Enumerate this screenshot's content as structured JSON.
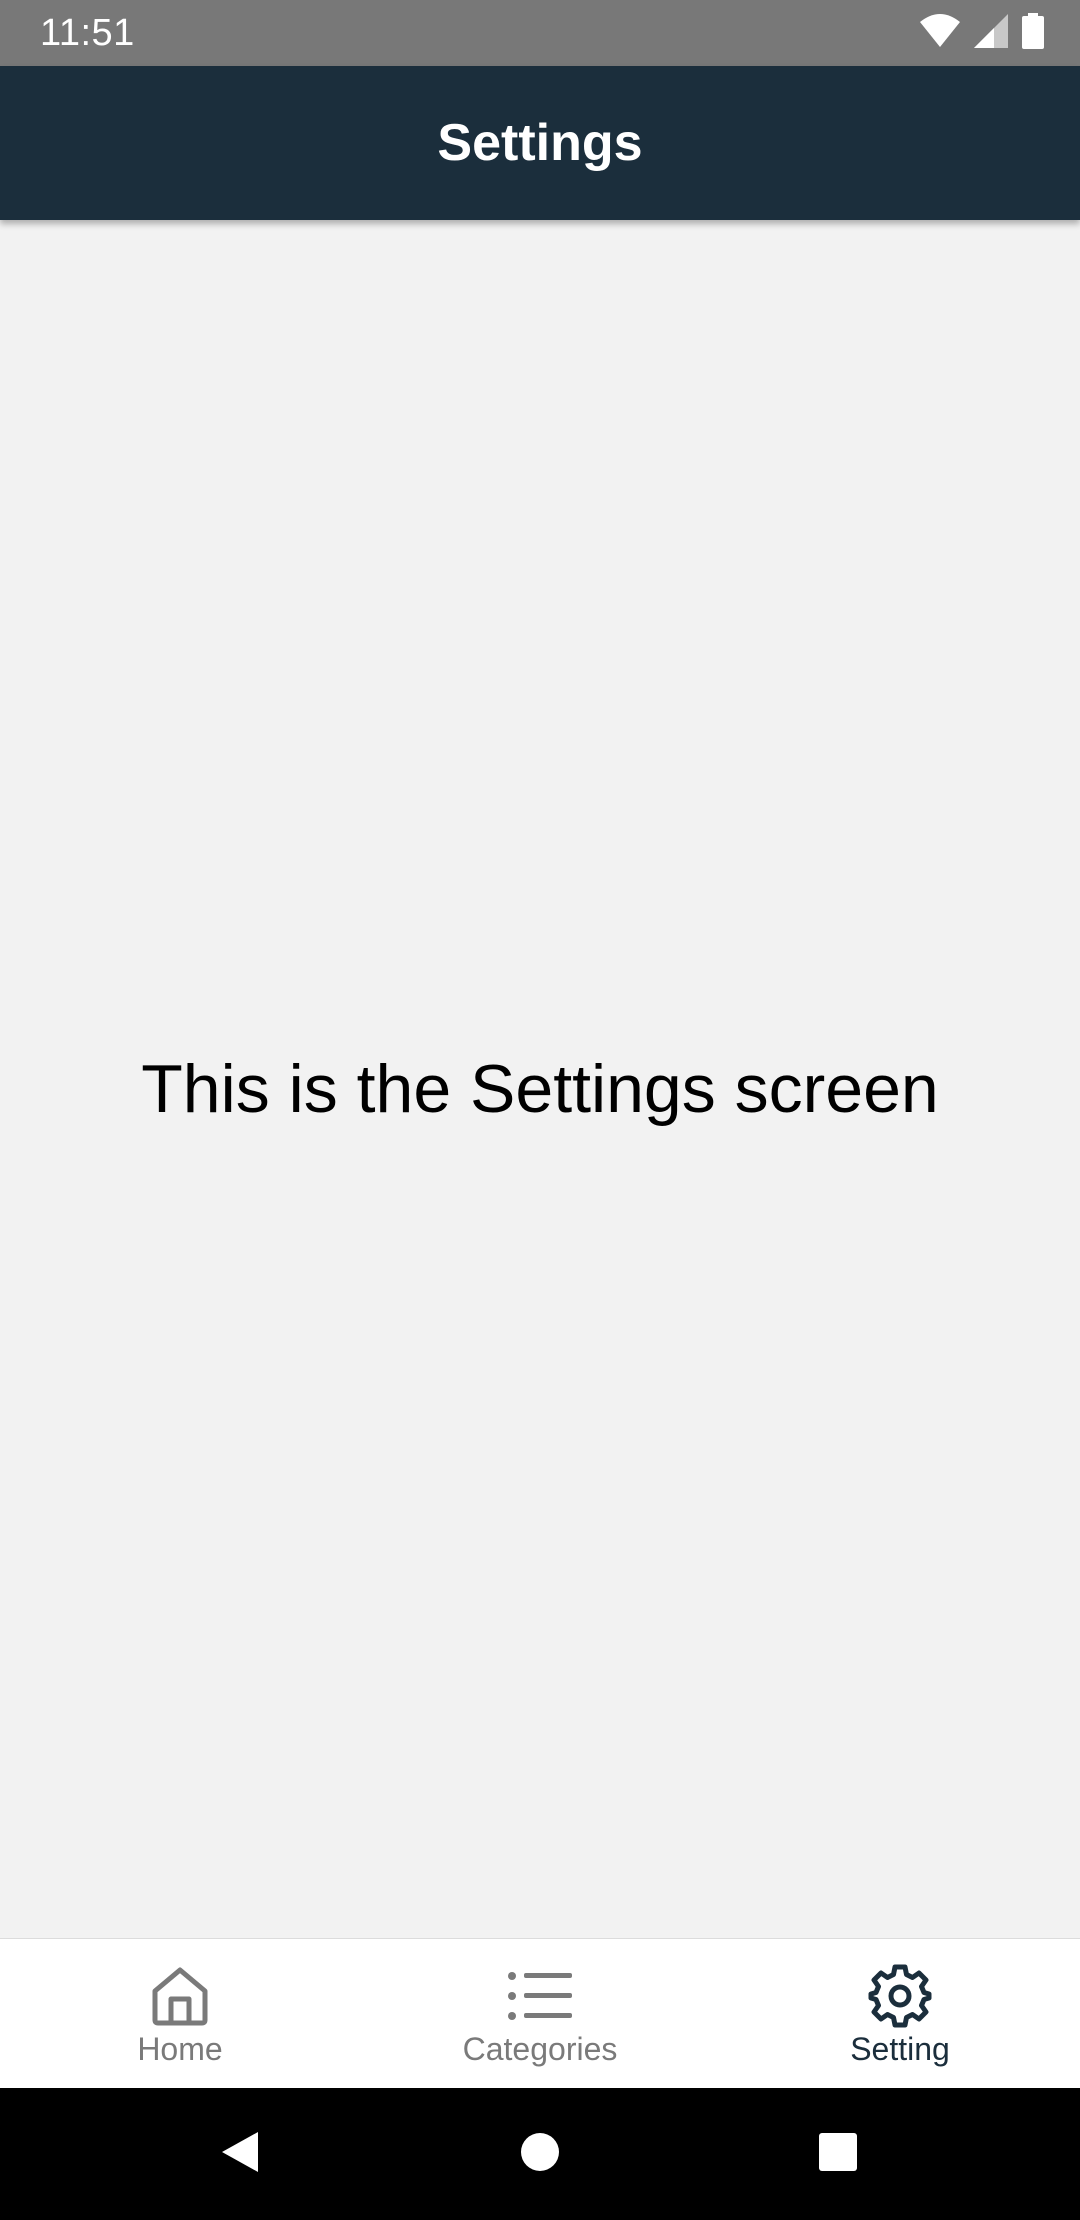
{
  "status_bar": {
    "time": "11:51",
    "icons": [
      "wifi-icon",
      "cell-signal-icon",
      "battery-icon"
    ]
  },
  "app_bar": {
    "title": "Settings"
  },
  "content": {
    "message": "This is the Settings screen"
  },
  "bottom_nav": {
    "items": [
      {
        "label": "Home",
        "icon": "home-icon",
        "active": false
      },
      {
        "label": "Categories",
        "icon": "list-icon",
        "active": false
      },
      {
        "label": "Setting",
        "icon": "gear-icon",
        "active": true
      }
    ]
  },
  "system_nav": {
    "buttons": [
      "back-icon",
      "home-circle-icon",
      "recents-icon"
    ]
  },
  "colors": {
    "app_bar": "#1b2e3c",
    "status_bar": "#787878",
    "background": "#f2f2f2",
    "nav_active": "#1b2e3c",
    "nav_inactive": "#7a7a7a"
  }
}
